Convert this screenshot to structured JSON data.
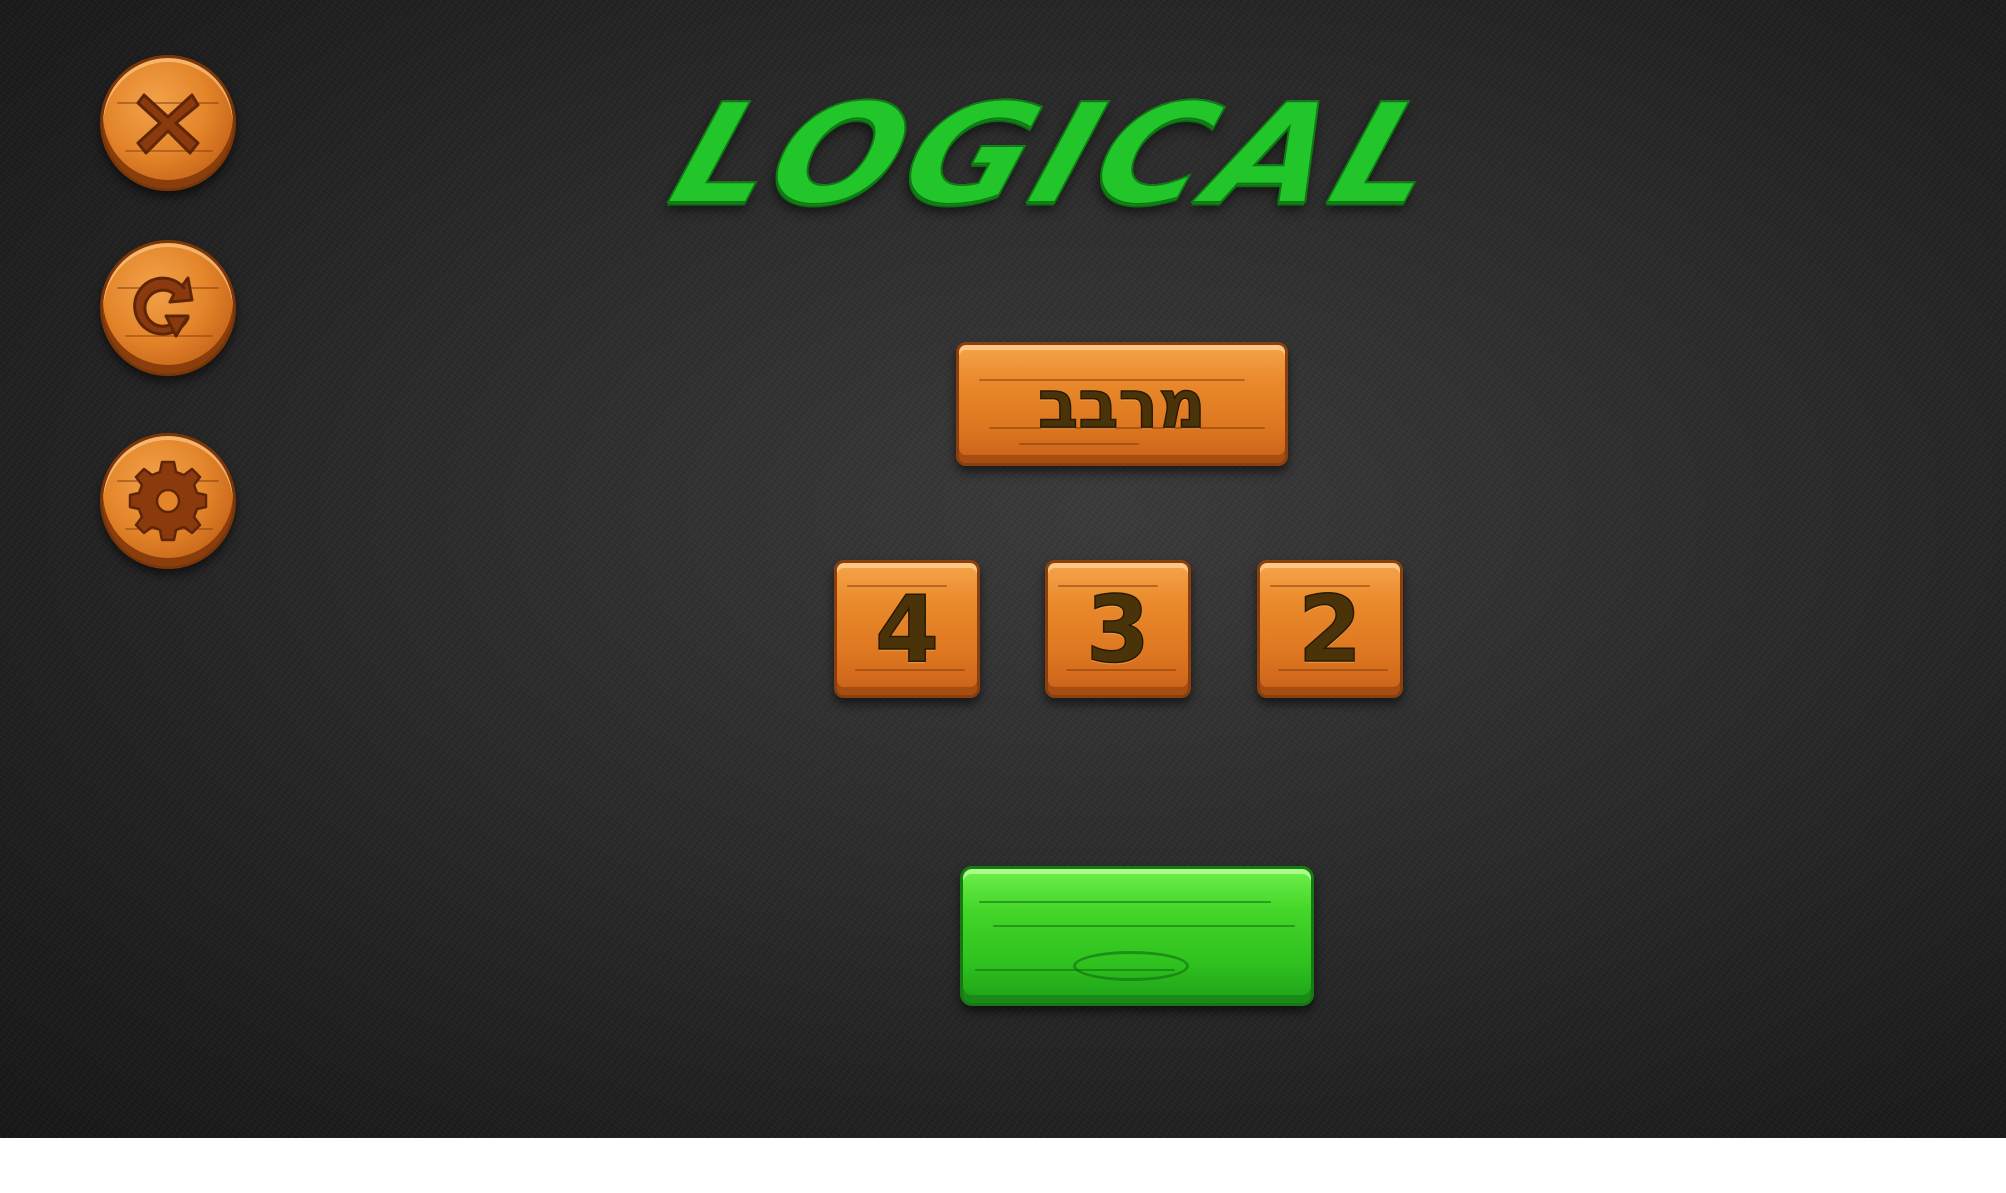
{
  "game": {
    "title": "LOGICAL",
    "mode_label": "מרבב",
    "size_options": [
      "4",
      "3",
      "2"
    ],
    "play_label": ""
  },
  "controls": {
    "close_icon": "close-icon",
    "restart_icon": "restart-icon",
    "settings_icon": "gear-icon"
  },
  "colors": {
    "background": "#2a2a2a",
    "wood_orange": "#e4852a",
    "wood_text": "#4a3308",
    "title_green": "#22c52a",
    "play_green": "#3bcf25"
  }
}
